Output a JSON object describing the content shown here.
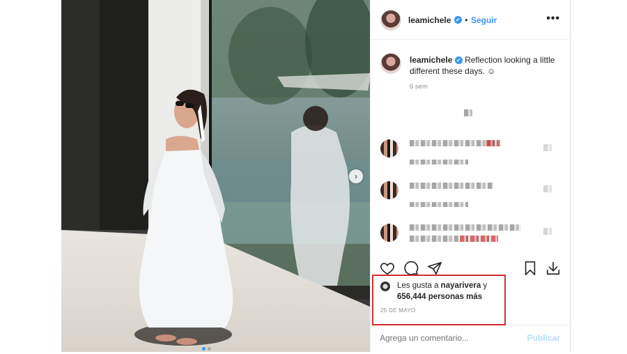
{
  "post": {
    "username": "leamichele",
    "follow_label": "Seguir",
    "separator": "•",
    "verified_glyph": "✔",
    "more_glyph": "•••",
    "caption": "Reflection looking a little different these days. ☺",
    "caption_age": "6 sem"
  },
  "icons": [
    "verified-icon",
    "more-options-icon",
    "heart-icon",
    "comment-icon",
    "share-icon",
    "bookmark-icon",
    "download-icon",
    "next-arrow-icon"
  ],
  "likes": {
    "prefix": "Les gusta a",
    "liker": "nayarivera",
    "connector": "y",
    "count": "656,444 personas más"
  },
  "date": "25 DE MAYO",
  "comment_box": {
    "placeholder": "Agrega un comentario...",
    "publish_label": "Publicar"
  },
  "carousel": {
    "next_glyph": "›"
  },
  "colors": {
    "accent": "#3897f0",
    "highlight_box": "#d32f2f",
    "publish_disabled": "#b2dffc"
  }
}
